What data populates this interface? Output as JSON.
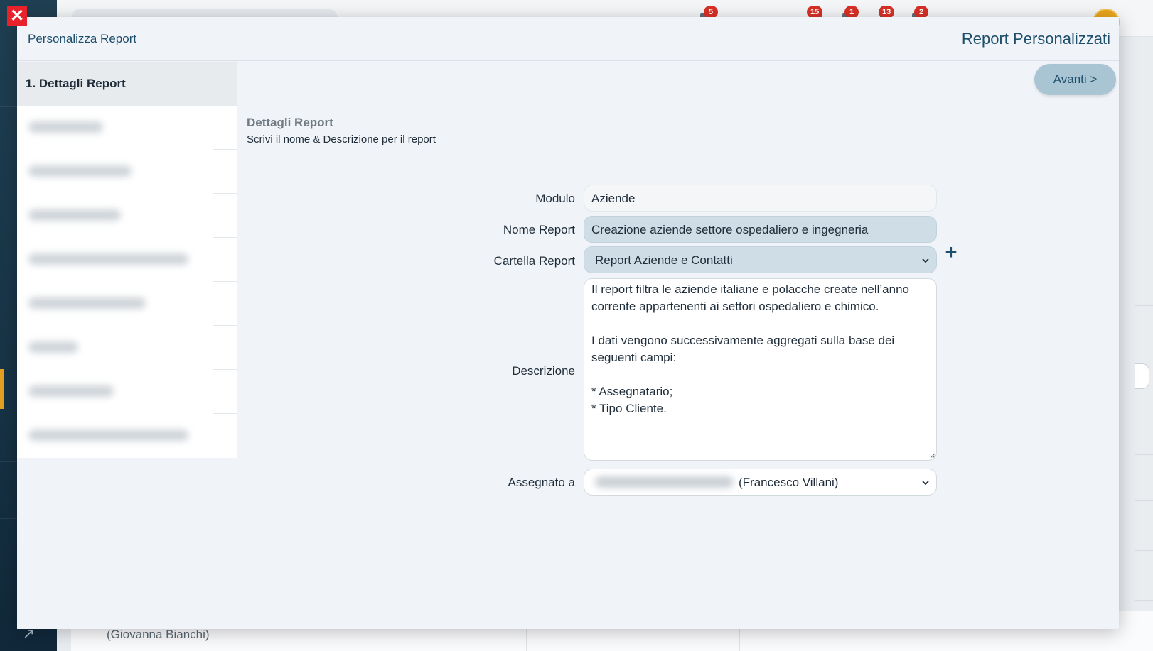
{
  "background": {
    "notification_badges": [
      "5",
      "15",
      "1",
      "13",
      "2"
    ],
    "table_row_text": "(Giovanna Bianchi)"
  },
  "modal": {
    "header_left": "Personalizza Report",
    "header_right": "Report Personalizzati",
    "next_button": "Avanti >",
    "steps": [
      {
        "label": "1. Dettagli Report",
        "active": true,
        "blurred": false
      },
      {
        "label": "",
        "blurred": true
      },
      {
        "label": "",
        "blurred": true
      },
      {
        "label": "",
        "blurred": true
      },
      {
        "label": "",
        "blurred": true
      },
      {
        "label": "",
        "blurred": true
      },
      {
        "label": "",
        "blurred": true
      },
      {
        "label": "",
        "blurred": true
      },
      {
        "label": "",
        "blurred": true
      }
    ],
    "section": {
      "title": "Dettagli Report",
      "subtitle": "Scrivi il nome & Descrizione per il report"
    },
    "form": {
      "module_label": "Modulo",
      "module_value": "Aziende",
      "name_label": "Nome Report",
      "name_value": "Creazione aziende settore ospedaliero e ingegneria",
      "folder_label": "Cartella Report",
      "folder_value": "Report Aziende e Contatti",
      "description_label": "Descrizione",
      "description_value": "Il report filtra le aziende italiane e polacche create nell’anno corrente appartenenti ai settori ospedaliero e chimico.\n\nI dati vengono successivamente aggregati sulla base dei seguenti campi:\n\n* Assegnatario;\n* Tipo Cliente.",
      "assigned_label": "Assegnato a",
      "assigned_value": "(Francesco Villani)"
    }
  },
  "icons": {
    "close": "close-icon",
    "add_folder": "plus-icon",
    "dropdown": "chevron-down-icon"
  },
  "colors": {
    "accent": "#1d4e6b",
    "close_red": "#e8222b",
    "badge_red": "#d93025",
    "active_orange": "#e5a021"
  }
}
